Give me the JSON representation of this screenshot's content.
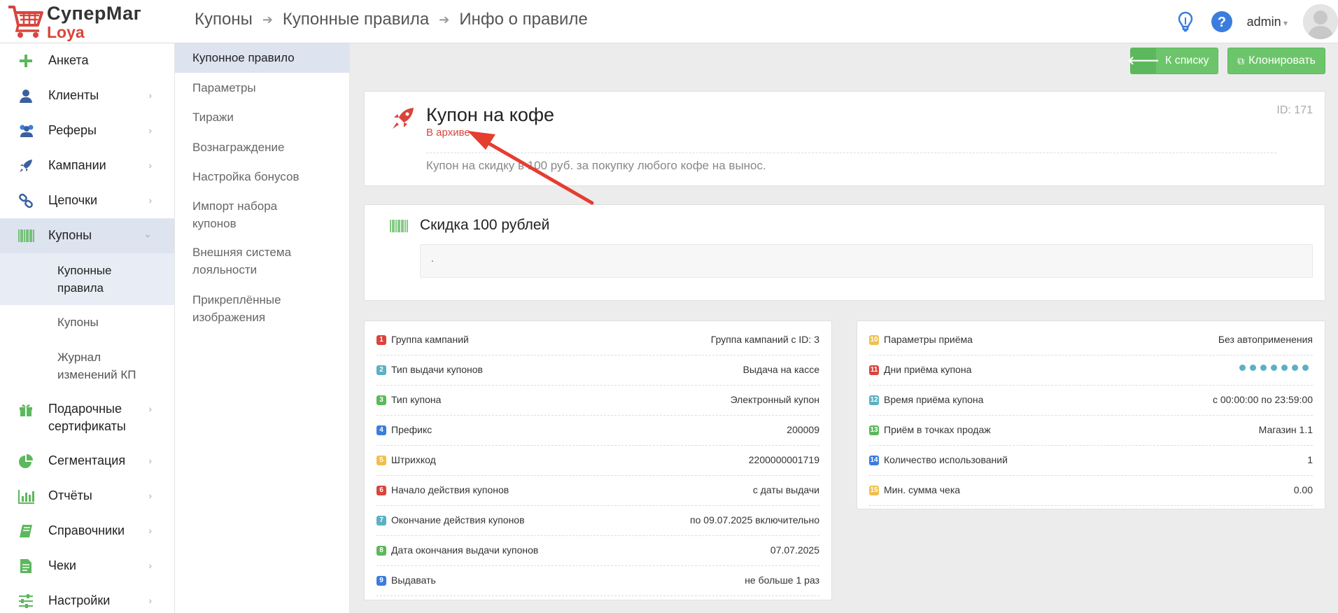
{
  "app": {
    "logo_title": "СуперМаг",
    "logo_subtitle": "Loya"
  },
  "header": {
    "breadcrumb": [
      "Купоны",
      "Купонные правила",
      "Инфо о правиле"
    ],
    "user": "admin"
  },
  "sidebar": {
    "items": [
      {
        "label": "Анкета",
        "icon": "plus-icon"
      },
      {
        "label": "Клиенты",
        "icon": "user-icon"
      },
      {
        "label": "Реферы",
        "icon": "users-icon"
      },
      {
        "label": "Кампании",
        "icon": "rocket-icon"
      },
      {
        "label": "Цепочки",
        "icon": "link-icon"
      },
      {
        "label": "Купоны",
        "icon": "barcode-icon"
      },
      {
        "label": "Подарочные сертификаты",
        "icon": "gift-icon"
      },
      {
        "label": "Сегментация",
        "icon": "pie-chart-icon"
      },
      {
        "label": "Отчёты",
        "icon": "bar-chart-icon"
      },
      {
        "label": "Справочники",
        "icon": "book-icon"
      },
      {
        "label": "Чеки",
        "icon": "receipt-icon"
      },
      {
        "label": "Настройки",
        "icon": "sliders-icon"
      }
    ],
    "subitems": [
      "Купонные правила",
      "Купоны",
      "Журнал изменений КП"
    ]
  },
  "subnav": {
    "items": [
      "Купонное правило",
      "Параметры",
      "Тиражи",
      "Вознаграждение",
      "Настройка бонусов",
      "Импорт набора купонов",
      "Внешняя система лояльности",
      "Прикреплённые изображения"
    ]
  },
  "toolbar": {
    "back_label": "К списку",
    "clone_label": "Клонировать"
  },
  "rule": {
    "title": "Купон на кофе",
    "status": "В архиве",
    "id": "ID: 171",
    "description": "Купон на скидку в 100 руб. за покупку любого кофе на вынос."
  },
  "reward": {
    "title": "Скидка 100 рублей",
    "body": "."
  },
  "params_left": [
    {
      "n": "1",
      "color": "red",
      "label": "Группа кампаний",
      "value": "Группа кампаний с ID: 3"
    },
    {
      "n": "2",
      "color": "teal",
      "label": "Тип выдачи купонов",
      "value": "Выдача на кассе"
    },
    {
      "n": "3",
      "color": "green",
      "label": "Тип купона",
      "value": "Электронный купон"
    },
    {
      "n": "4",
      "color": "blue",
      "label": "Префикс",
      "value": "200009"
    },
    {
      "n": "5",
      "color": "yellow",
      "label": "Штрихкод",
      "value": "2200000001719"
    },
    {
      "n": "6",
      "color": "red",
      "label": "Начало действия купонов",
      "value": "с даты выдачи"
    },
    {
      "n": "7",
      "color": "teal",
      "label": "Окончание действия купонов",
      "value": "по 09.07.2025 включительно"
    },
    {
      "n": "8",
      "color": "green",
      "label": "Дата окончания выдачи купонов",
      "value": "07.07.2025"
    },
    {
      "n": "9",
      "color": "blue",
      "label": "Выдавать",
      "value": "не больше 1 раз"
    }
  ],
  "params_right": [
    {
      "n": "10",
      "color": "yellow",
      "label": "Параметры приёма",
      "value": "Без автоприменения"
    },
    {
      "n": "11",
      "color": "red",
      "label": "Дни приёма купона",
      "value": ""
    },
    {
      "n": "12",
      "color": "teal",
      "label": "Время приёма купона",
      "value": "с 00:00:00 по 23:59:00"
    },
    {
      "n": "13",
      "color": "green",
      "label": "Приём в точках продаж",
      "value": "Магазин 1.1"
    },
    {
      "n": "14",
      "color": "blue",
      "label": "Количество использований",
      "value": "1"
    },
    {
      "n": "15",
      "color": "yellow",
      "label": "Мин. сумма чека",
      "value": "0.00"
    }
  ],
  "days_dots": 7
}
